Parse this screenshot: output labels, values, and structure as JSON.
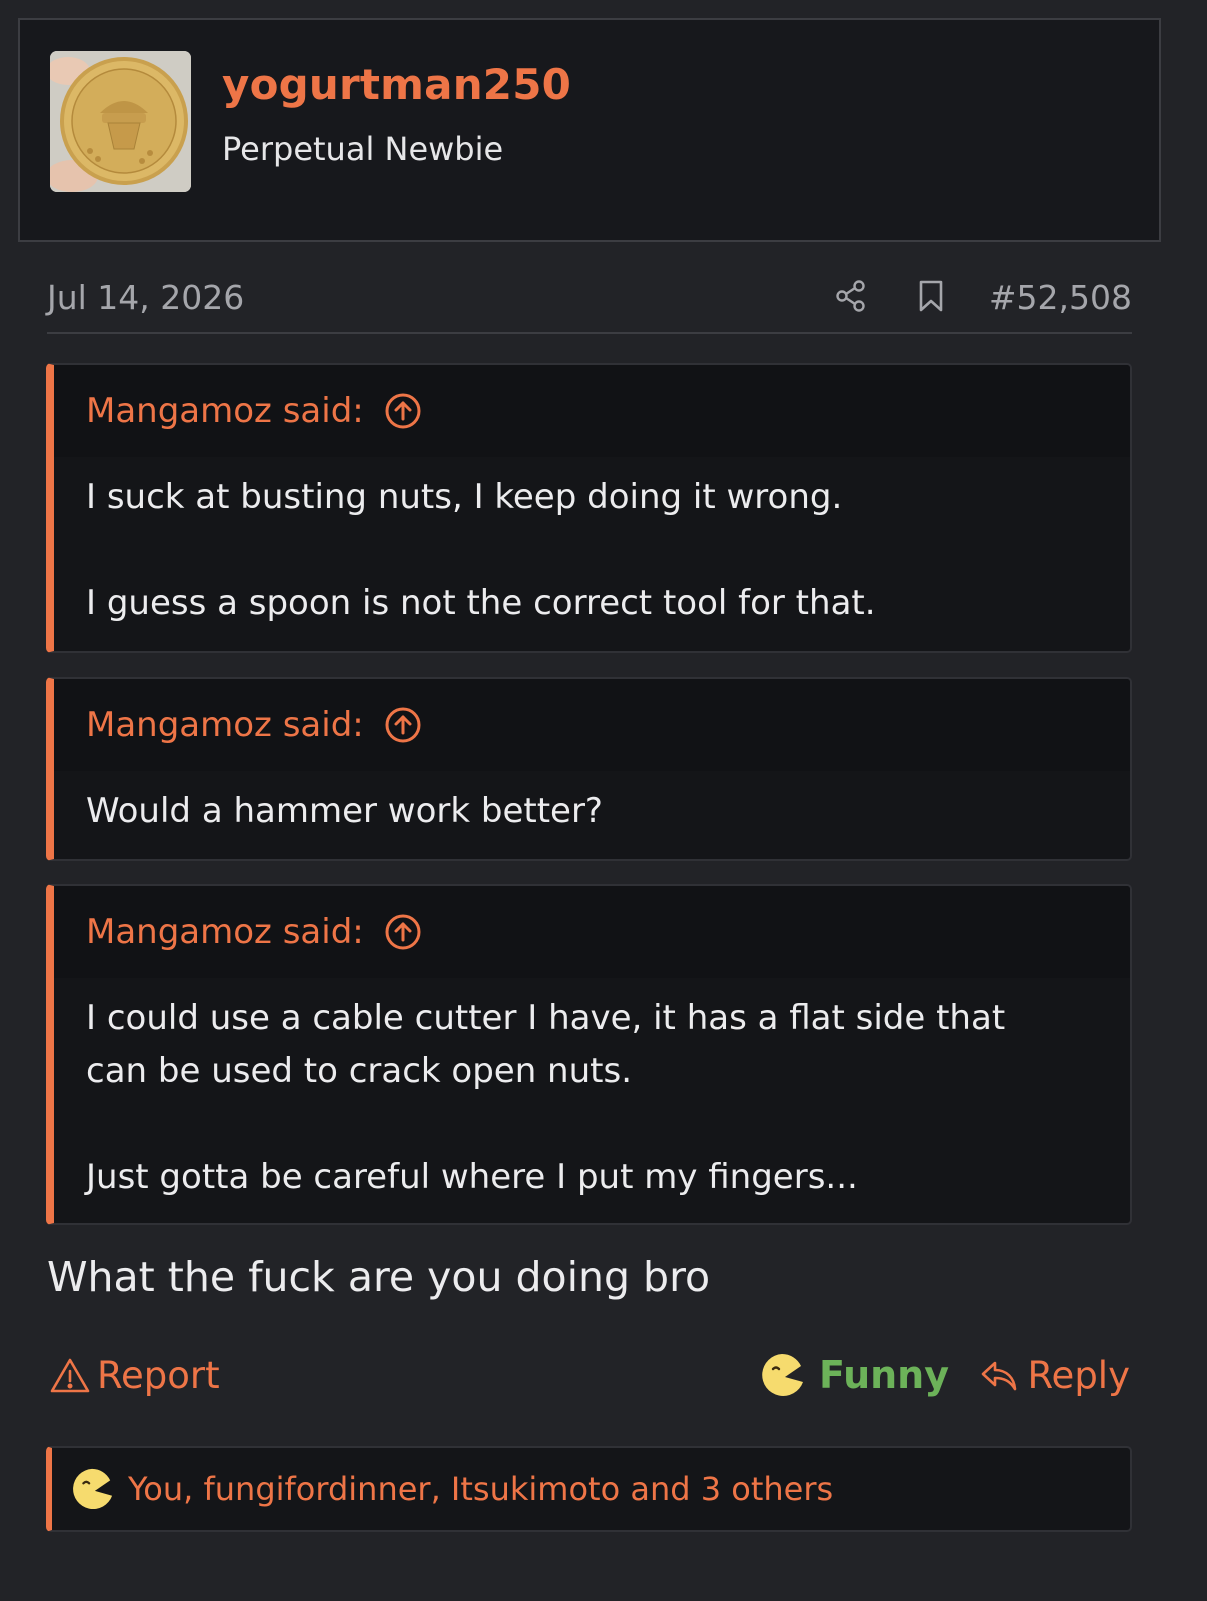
{
  "user": {
    "username": "yogurtman250",
    "title": "Perpetual Newbie",
    "avatar_icon": "gold-medal-avatar"
  },
  "post": {
    "date": "Jul 14, 2026",
    "number": "#52,508",
    "message": "What the fuck are you doing bro"
  },
  "quotes": [
    {
      "attribution": "Mangamoz said:",
      "paragraphs": [
        "I suck at busting nuts, I keep doing it wrong.",
        "I guess a spoon is not the correct tool for that."
      ]
    },
    {
      "attribution": "Mangamoz said:",
      "paragraphs": [
        "Would a hammer work better?"
      ]
    },
    {
      "attribution": "Mangamoz said:",
      "paragraphs": [
        "I could use a cable cutter I have, it has a flat side that can be used to crack open nuts.",
        "Just gotta be careful where I put my fingers..."
      ]
    }
  ],
  "actions": {
    "report_label": "Report",
    "funny_label": "Funny",
    "reply_label": "Reply"
  },
  "reactions": {
    "summary": "You, fungifordinner, Itsukimoto and 3 others",
    "icon": "laughing-face-icon"
  },
  "colors": {
    "accent": "#ee7547",
    "funny_green": "#6cb259",
    "background": "#222327",
    "card": "#17181c",
    "emoji_yellow": "#f6db6e"
  }
}
